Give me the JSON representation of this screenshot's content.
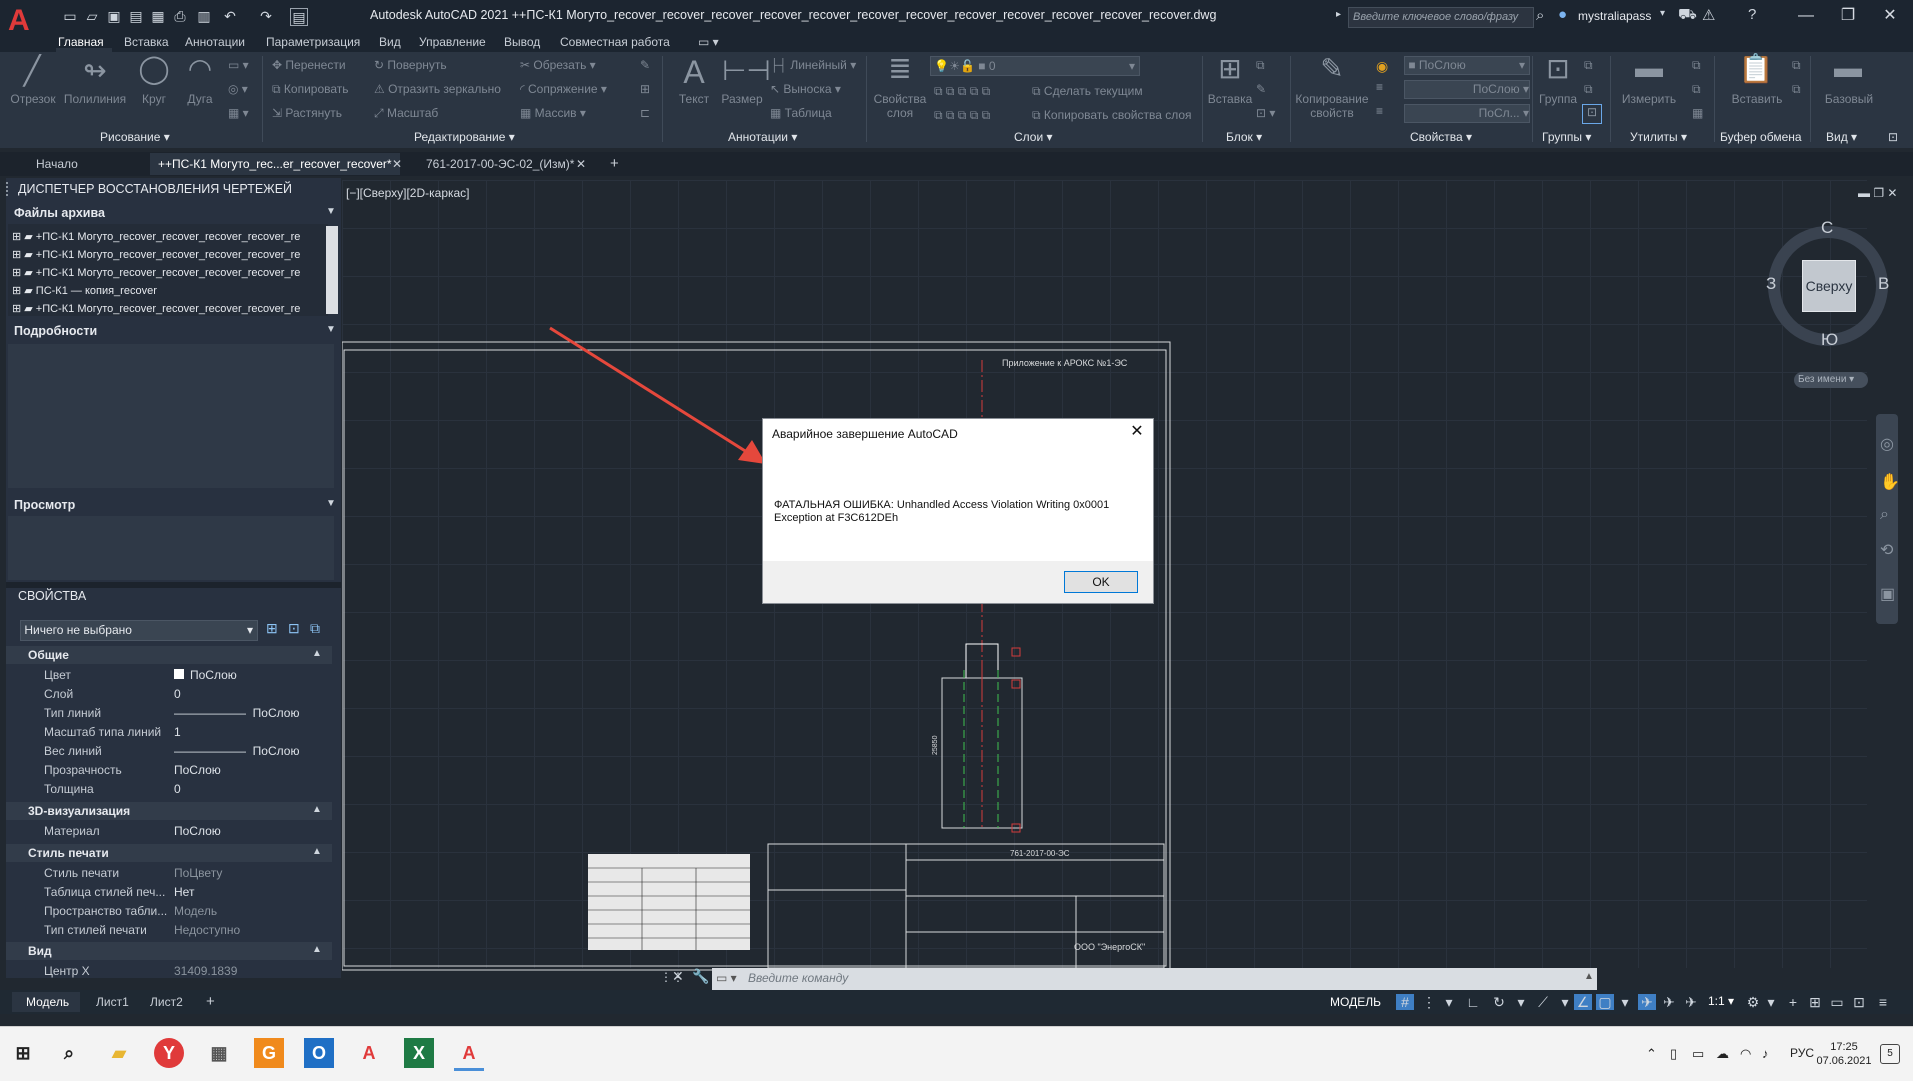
{
  "app": {
    "title": "Autodesk AutoCAD 2021   ++ПС-К1 Могуто_recover_recover_recover_recover_recover_recover_recover_recover_recover_recover_recover_recover.dwg",
    "search_placeholder": "Введите ключевое слово/фразу",
    "user": "mystraliapass"
  },
  "ribbon_tabs": [
    "Главная",
    "Вставка",
    "Аннотации",
    "Параметризация",
    "Вид",
    "Управление",
    "Вывод",
    "Совместная работа"
  ],
  "ribbon": {
    "draw": {
      "title": "Рисование",
      "tools": [
        "Отрезок",
        "Полилиния",
        "Круг",
        "Дуга"
      ]
    },
    "modify": {
      "title": "Редактирование",
      "tools": [
        "Перенести",
        "Повернуть",
        "Обрезать",
        "Копировать",
        "Отразить зеркально",
        "Сопряжение",
        "Растянуть",
        "Масштаб",
        "Массив"
      ]
    },
    "annotation": {
      "title": "Аннотации",
      "tools": [
        "Текст",
        "Размер",
        "Линейный",
        "Выноска",
        "Таблица"
      ]
    },
    "layers": {
      "title": "Слои",
      "big": "Свойства\nслоя",
      "current_layer": "0",
      "tools": [
        "Сделать текущим",
        "Копировать свойства слоя"
      ]
    },
    "block": {
      "title": "Блок",
      "big": "Вставка"
    },
    "properties": {
      "title": "Свойства",
      "big": "Копирование\nсвойств",
      "color": "ПоСлою",
      "linetype": "ПоСлою",
      "lineweight": "ПоСл..."
    },
    "groups": {
      "title": "Группы",
      "big": "Группа"
    },
    "utilities": {
      "title": "Утилиты",
      "big": "Измерить"
    },
    "clipboard": {
      "title": "Буфер обмена",
      "big": "Вставить"
    },
    "view": {
      "title": "Вид",
      "big": "Базовый"
    }
  },
  "doc_tabs": [
    "Начало",
    "++ПС-К1 Могуто_rec...er_recover_recover*",
    "761-2017-00-ЭС-02_(Изм)*"
  ],
  "recovery": {
    "title": "ДИСПЕТЧЕР ВОССТАНОВЛЕНИЯ ЧЕРТЕЖЕЙ",
    "archive_header": "Файлы архива",
    "files": [
      "+ПС-К1 Могуто_recover_recover_recover_recover_re",
      "+ПС-К1 Могуто_recover_recover_recover_recover_re",
      "+ПС-К1 Могуто_recover_recover_recover_recover_re",
      "ПС-К1 — копия_recover",
      "+ПС-К1 Могуто_recover_recover_recover_recover_re"
    ],
    "details_header": "Подробности",
    "preview_header": "Просмотр"
  },
  "properties": {
    "title": "СВОЙСТВА",
    "selection": "Ничего не выбрано",
    "general": {
      "header": "Общие",
      "rows": [
        {
          "label": "Цвет",
          "value": "ПоСлою"
        },
        {
          "label": "Слой",
          "value": "0"
        },
        {
          "label": "Тип линий",
          "value": "ПоСлою"
        },
        {
          "label": "Масштаб типа линий",
          "value": "1"
        },
        {
          "label": "Вес линий",
          "value": "ПоСлою"
        },
        {
          "label": "Прозрачность",
          "value": "ПоСлою"
        },
        {
          "label": "Толщина",
          "value": "0"
        }
      ]
    },
    "viz3d": {
      "header": "3D-визуализация",
      "rows": [
        {
          "label": "Материал",
          "value": "ПоСлою"
        }
      ]
    },
    "plot": {
      "header": "Стиль печати",
      "rows": [
        {
          "label": "Стиль печати",
          "value": "ПоЦвету"
        },
        {
          "label": "Таблица стилей печ...",
          "value": "Нет"
        },
        {
          "label": "Пространство табли...",
          "value": "Модель"
        },
        {
          "label": "Тип стилей печати",
          "value": "Недоступно"
        }
      ]
    },
    "view": {
      "header": "Вид",
      "rows": [
        {
          "label": "Центр X",
          "value": "31409.1839"
        }
      ]
    }
  },
  "viewport": {
    "label": "[−][Сверху][2D-каркас]",
    "viewcube": {
      "face": "Сверху",
      "n": "С",
      "s": "Ю",
      "w": "З",
      "e": "В",
      "ucs": "Без имени"
    },
    "sheet_note": "Приложение к АРОКС №1-ЭС",
    "dim_text": "25850",
    "stamp_code": "761-2017-00-ЭС",
    "company": "ООО \"ЭнергоСК\""
  },
  "dialog": {
    "title": "Аварийное завершение AutoCAD",
    "message": "ФАТАЛЬНАЯ ОШИБКА:  Unhandled Access Violation Writing 0x0001\nException at F3C612DEh",
    "ok": "OK"
  },
  "command": {
    "placeholder": "Введите команду"
  },
  "layout_tabs": [
    "Модель",
    "Лист1",
    "Лист2"
  ],
  "status": {
    "mode": "МОДЕЛЬ",
    "scale": "1:1"
  },
  "taskbar": {
    "lang": "РУС",
    "time": "17:25",
    "date": "07.06.2021",
    "notif": "5"
  },
  "colors": {
    "accent": "#e03a3a",
    "arrow": "#e5483c",
    "bg": "#212830"
  }
}
